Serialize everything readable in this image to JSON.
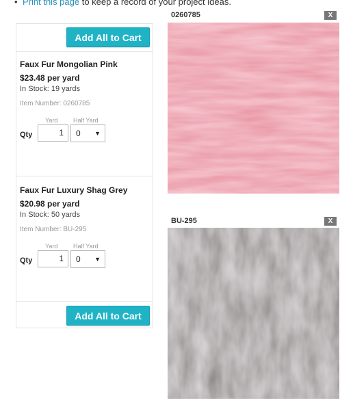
{
  "top_note": {
    "link_text": "Print this page",
    "rest_text": " to keep a record of your project ideas."
  },
  "cart": {
    "add_all_label_top": "Add All to Cart",
    "add_all_label_bottom": "Add All to Cart",
    "items": [
      {
        "name": "Faux Fur Mongolian Pink",
        "price": "$23.48 per yard",
        "stock": "In Stock: 19 yards",
        "item_number": "Item Number: 0260785",
        "yard_label": "Yard",
        "half_label": "Half Yard",
        "qty_label": "Qty",
        "yard_value": "1",
        "half_value": "0"
      },
      {
        "name": "Faux Fur Luxury Shag Grey",
        "price": "$20.98 per yard",
        "stock": "In Stock: 50 yards",
        "item_number": "Item Number: BU-295",
        "yard_label": "Yard",
        "half_label": "Half Yard",
        "qty_label": "Qty",
        "yard_value": "1",
        "half_value": "0"
      }
    ]
  },
  "swatches": [
    {
      "code": "0260785",
      "close": "X",
      "color": "#e68e9c"
    },
    {
      "code": "BU-295",
      "close": "X",
      "color": "#8a8486"
    }
  ],
  "colors": {
    "accent": "#1fb3c5",
    "link": "#2a8fb7"
  }
}
